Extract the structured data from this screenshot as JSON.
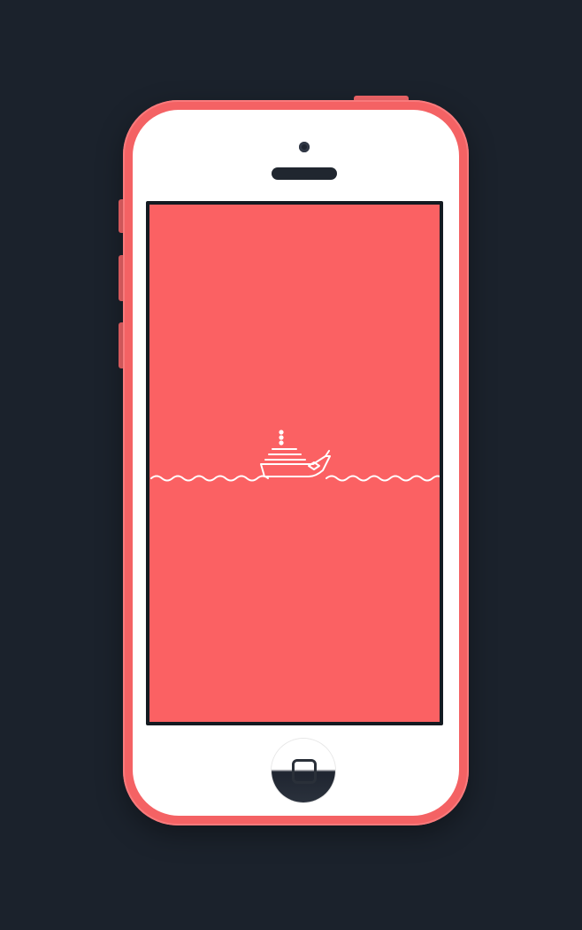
{
  "device": {
    "model": "phone-5c",
    "shell_color": "#f46264",
    "face_color": "#ffffff"
  },
  "screen": {
    "background_color": "#fb6163",
    "illustration": {
      "icon": "ship-icon",
      "stroke_color": "#ffffff",
      "waves": "wave-line"
    }
  },
  "hardware": {
    "home_button_icon": "home-square-icon",
    "camera": "front-camera",
    "speaker": "earpiece-speaker"
  }
}
